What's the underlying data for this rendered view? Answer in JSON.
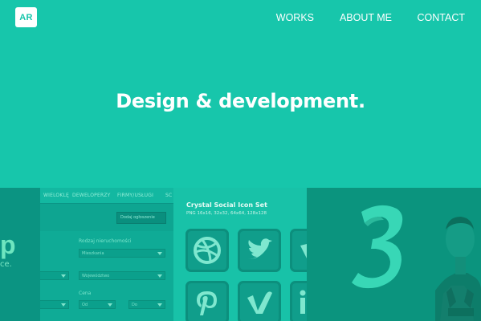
{
  "header": {
    "logo_text": "AR",
    "nav": [
      {
        "label": "WORKS"
      },
      {
        "label": "ABOUT ME"
      },
      {
        "label": "CONTACT"
      }
    ]
  },
  "hero": {
    "title": "Design & development."
  },
  "projects": {
    "form_preview": {
      "menu": [
        "WIELOKLĘ",
        "DEWELOPERZY",
        "FIRMY/USŁUGI",
        "SC"
      ],
      "button_text": "Dodaj ogłoszenie",
      "partial_letter": "p",
      "partial_text": "ce.",
      "label_type": "Rodzaj nieruchomości",
      "select_type": "Mieszkania",
      "select_region": "Województwo",
      "label_price": "Cena",
      "price_from": "Od",
      "price_to": "Do"
    },
    "icon_set": {
      "title": "Crystal Social Icon Set",
      "subtitle": "PNG 16x16, 32x32, 64x64, 128x128",
      "icons": [
        "dribbble-icon",
        "twitter-icon",
        "vimeo-icon",
        "pinterest-icon",
        "vimeo-icon",
        "linkedin-icon"
      ]
    },
    "sports_image": {
      "number": "3"
    }
  },
  "colors": {
    "background": "#17c6ab",
    "text": "#ffffff"
  }
}
